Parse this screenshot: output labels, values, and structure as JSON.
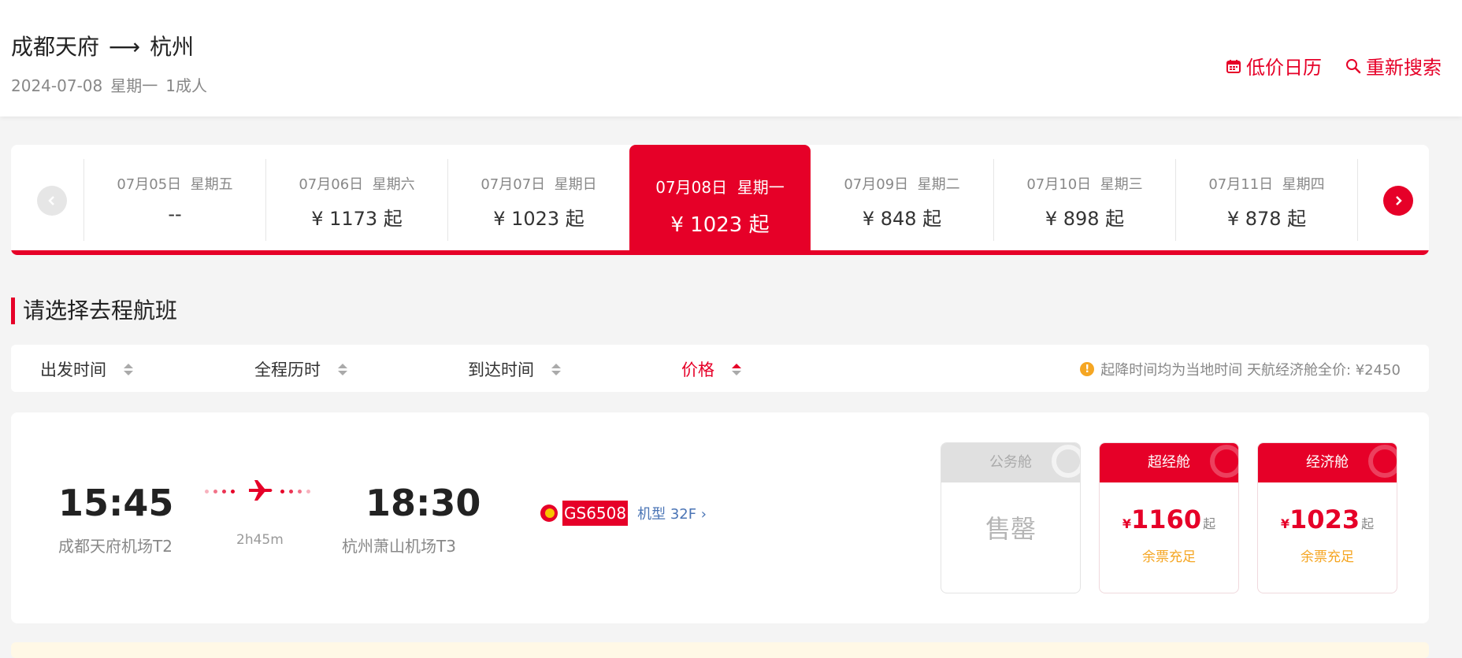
{
  "header": {
    "from": "成都天府",
    "arrow": "⟶",
    "to": "杭州",
    "date": "2024-07-08",
    "weekday": "星期一",
    "passengers": "1成人",
    "calendar_label": "低价日历",
    "research_label": "重新搜索"
  },
  "date_tabs": [
    {
      "date": "07月05日",
      "weekday": "星期五",
      "price": "--"
    },
    {
      "date": "07月06日",
      "weekday": "星期六",
      "price": "¥ 1173 起"
    },
    {
      "date": "07月07日",
      "weekday": "星期日",
      "price": "¥ 1023 起"
    },
    {
      "date": "07月08日",
      "weekday": "星期一",
      "price": "¥ 1023 起",
      "active": true
    },
    {
      "date": "07月09日",
      "weekday": "星期二",
      "price": "¥ 848 起"
    },
    {
      "date": "07月10日",
      "weekday": "星期三",
      "price": "¥ 898 起"
    },
    {
      "date": "07月11日",
      "weekday": "星期四",
      "price": "¥ 878 起"
    }
  ],
  "section_title": "请选择去程航班",
  "sort": {
    "depart": "出发时间",
    "duration": "全程历时",
    "arrive": "到达时间",
    "price": "价格",
    "active": "price",
    "notice": "起降时间均为当地时间 天航经济舱全价: ¥2450"
  },
  "flight": {
    "depart_time": "15:45",
    "depart_airport": "成都天府机场T2",
    "duration": "2h45m",
    "arrive_time": "18:30",
    "arrive_airport": "杭州萧山机场T3",
    "flight_no": "GS6508",
    "model": "机型 32F ›",
    "cabins": [
      {
        "name": "公务舱",
        "status": "售罄",
        "available": false
      },
      {
        "name": "超经舱",
        "currency": "¥",
        "price": "1160",
        "qi": "起",
        "stock": "余票充足",
        "available": true
      },
      {
        "name": "经济舱",
        "currency": "¥",
        "price": "1023",
        "qi": "起",
        "stock": "余票充足",
        "available": true
      }
    ]
  },
  "colors": {
    "accent": "#e60028",
    "warn": "#f5a623"
  }
}
